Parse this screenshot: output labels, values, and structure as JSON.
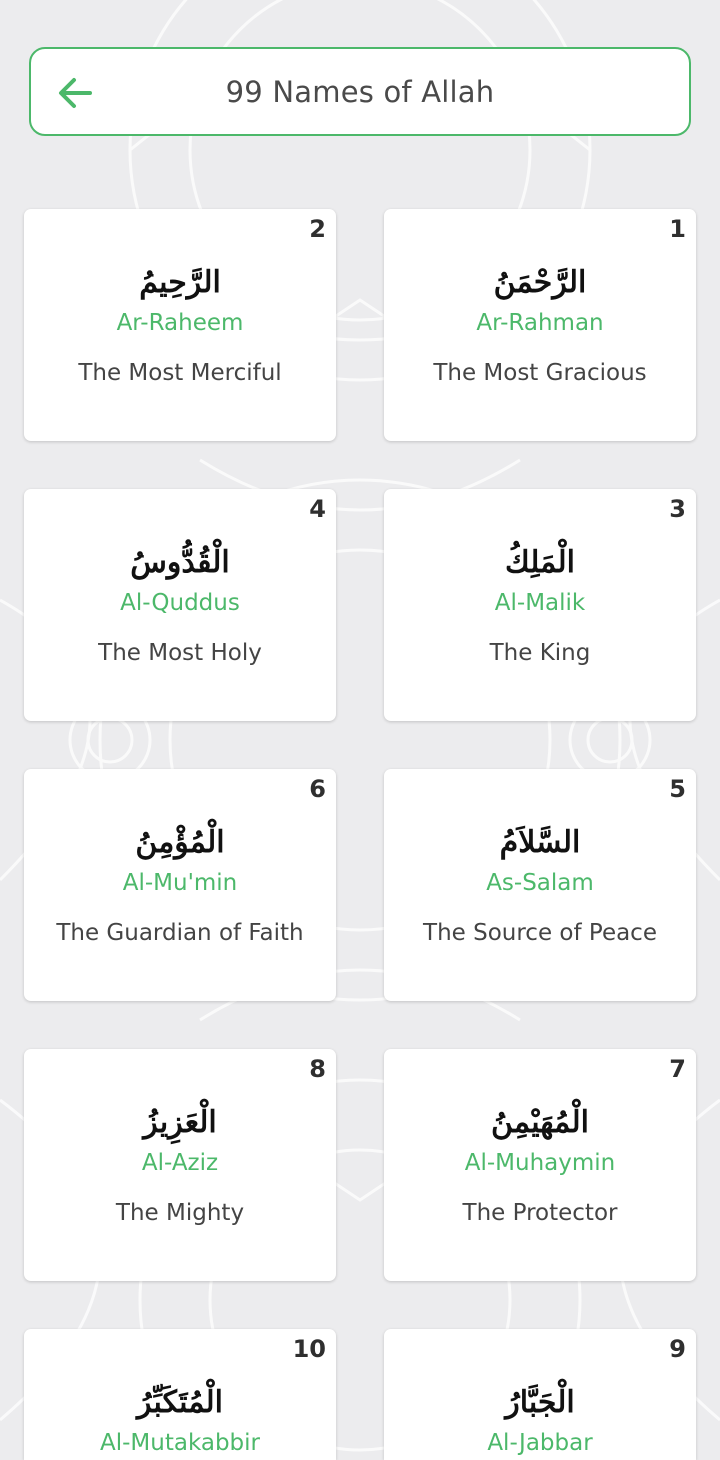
{
  "header": {
    "title": "99 Names of Allah",
    "back_icon": "arrow-left-icon"
  },
  "colors": {
    "accent": "#4cb86a",
    "background": "#ececee",
    "card": "#ffffff",
    "text": "#444444"
  },
  "names": [
    {
      "number": "1",
      "arabic": "الرَّحْمَنُ",
      "transliteration": "Ar-Rahman",
      "meaning": "The Most Gracious"
    },
    {
      "number": "2",
      "arabic": "الرَّحِيمُ",
      "transliteration": "Ar-Raheem",
      "meaning": "The Most Merciful"
    },
    {
      "number": "3",
      "arabic": "الْمَلِكُ",
      "transliteration": "Al-Malik",
      "meaning": "The King"
    },
    {
      "number": "4",
      "arabic": "الْقُدُّوسُ",
      "transliteration": "Al-Quddus",
      "meaning": "The Most Holy"
    },
    {
      "number": "5",
      "arabic": "السَّلاَمُ",
      "transliteration": "As-Salam",
      "meaning": "The Source of Peace"
    },
    {
      "number": "6",
      "arabic": "الْمُؤْمِنُ",
      "transliteration": "Al-Mu'min",
      "meaning": "The Guardian of Faith"
    },
    {
      "number": "7",
      "arabic": "الْمُهَيْمِنُ",
      "transliteration": "Al-Muhaymin",
      "meaning": "The Protector"
    },
    {
      "number": "8",
      "arabic": "الْعَزِيزُ",
      "transliteration": "Al-Aziz",
      "meaning": "The Mighty"
    },
    {
      "number": "9",
      "arabic": "الْجَبَّارُ",
      "transliteration": "Al-Jabbar",
      "meaning": ""
    },
    {
      "number": "10",
      "arabic": "الْمُتَكَبِّرُ",
      "transliteration": "Al-Mutakabbir",
      "meaning": ""
    }
  ]
}
